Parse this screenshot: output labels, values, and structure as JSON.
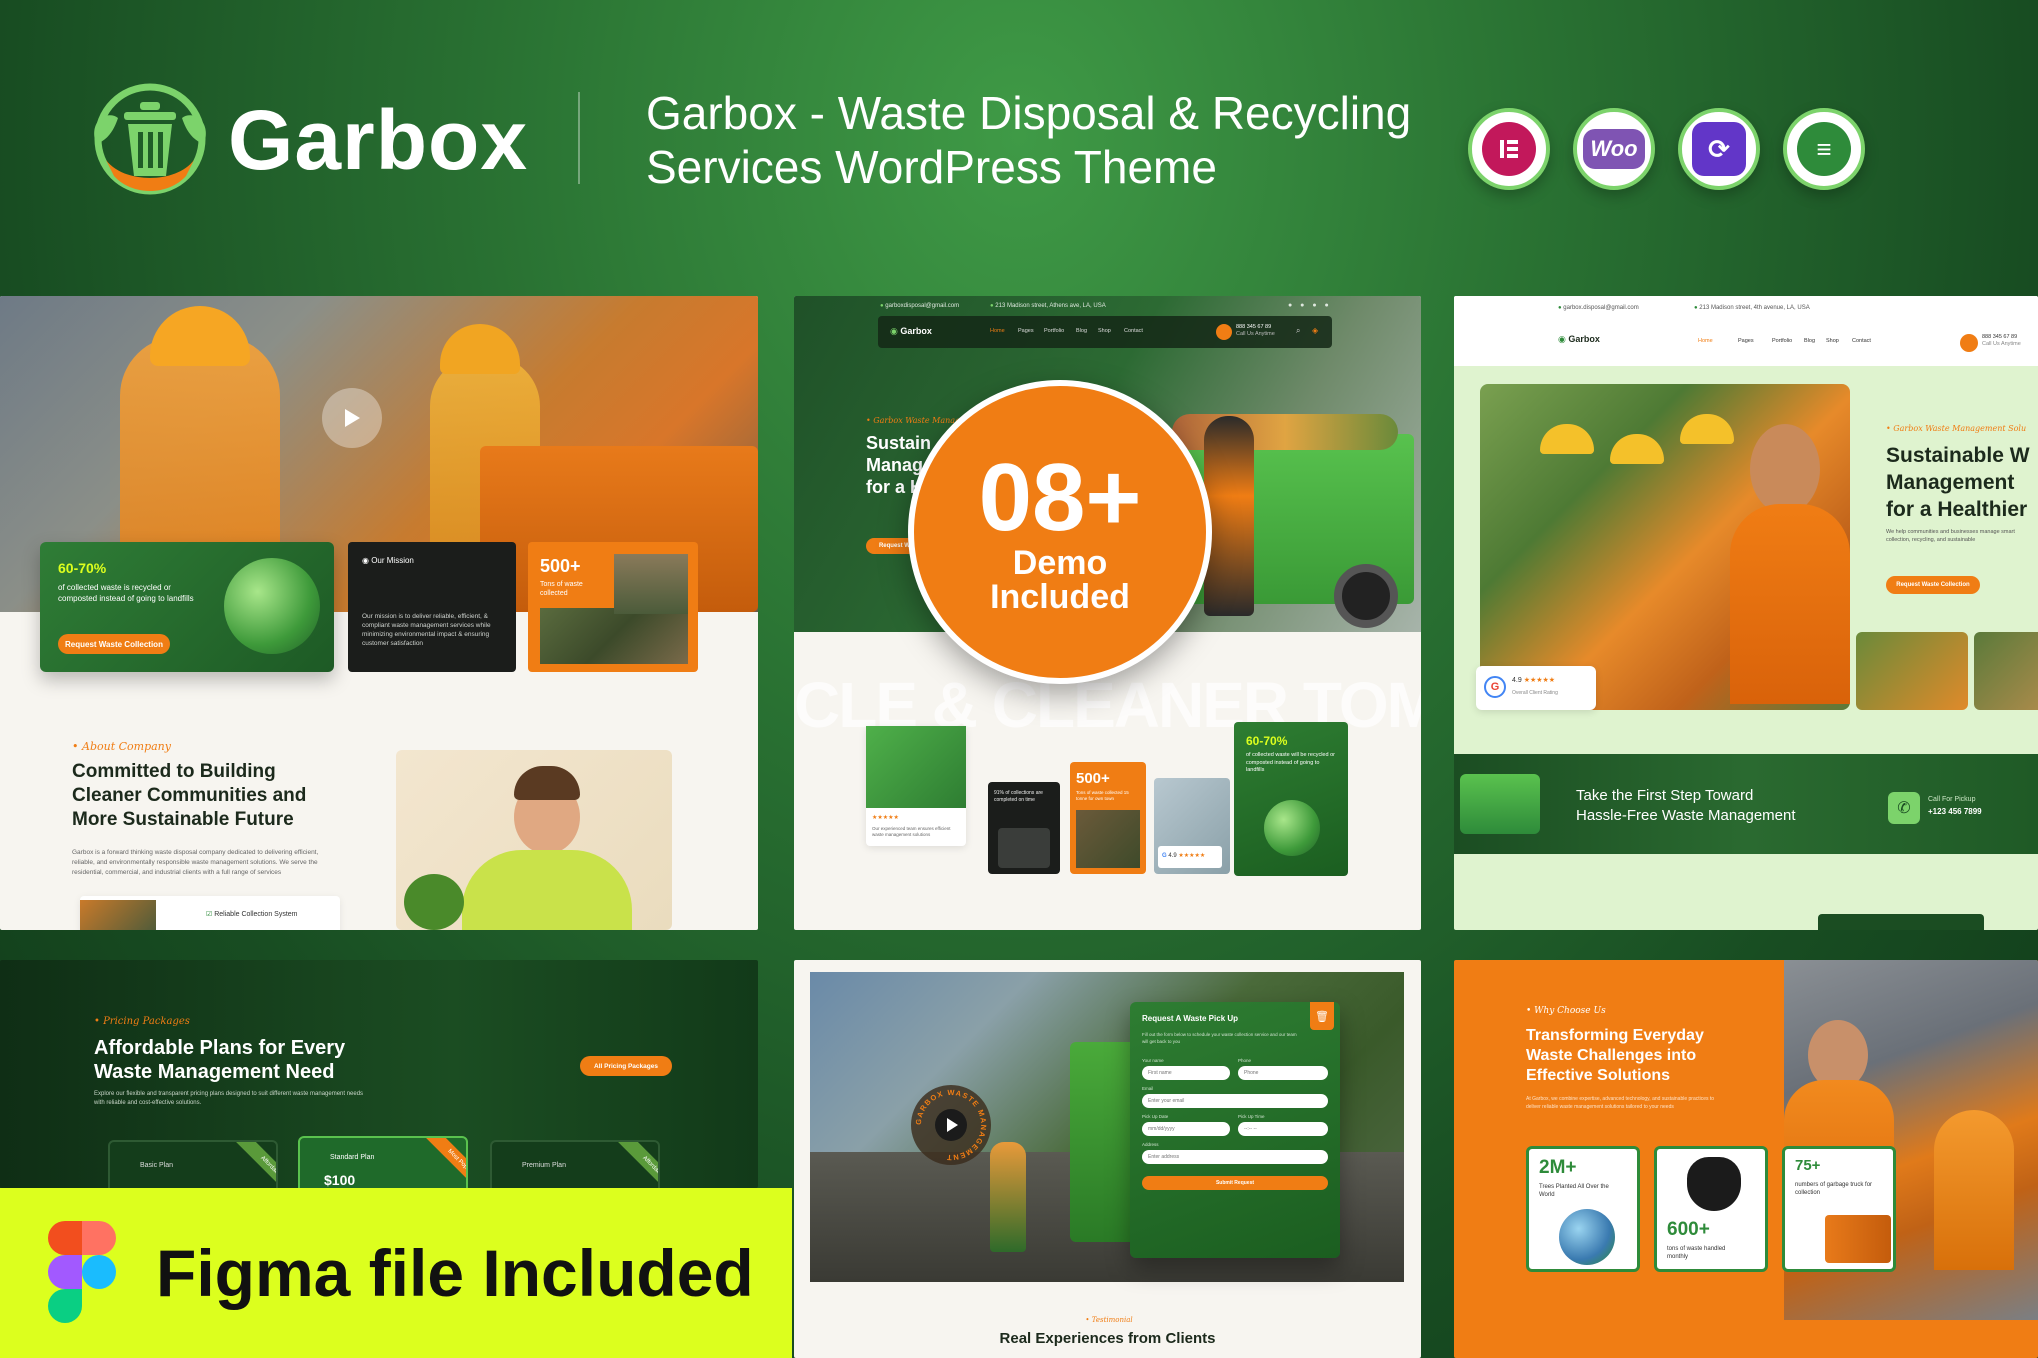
{
  "header": {
    "brand": "Garbox",
    "tagline_line1": "Garbox - Waste Disposal & Recycling",
    "tagline_line2": "Services WordPress Theme",
    "badges": [
      {
        "icon": "elementor-icon",
        "label": "E",
        "color": "#c2185b"
      },
      {
        "icon": "woocommerce-icon",
        "label": "Woo",
        "color": "#7f54b3"
      },
      {
        "icon": "update-sync-icon",
        "label": "⟳",
        "color": "#6236c8"
      },
      {
        "icon": "stack-layers-icon",
        "label": "≡",
        "color": "#2e8b3a"
      }
    ]
  },
  "colors": {
    "accent": "#f07d14",
    "brand_green": "#2a7333",
    "lime": "#dcff1e"
  },
  "demo_badge": {
    "number": "08+",
    "label_line1": "Demo",
    "label_line2": "Included"
  },
  "figma_banner": {
    "label": "Figma file Included"
  },
  "panel1": {
    "stat1_value": "60-70%",
    "stat1_text": "of collected waste is recycled or composted instead of going to landfills",
    "stat1_button": "Request Waste Collection",
    "mission_title": "Our Mission",
    "mission_text": "Our mission is to deliver reliable, efficient, & compliant waste management services while minimizing environmental impact & ensuring customer satisfaction",
    "stat2_value": "500+",
    "stat2_text": "Tons of waste collected",
    "about_eyebrow": "About Company",
    "about_h1": "Committed to Building",
    "about_h2": "Cleaner Communities and",
    "about_h3": "More Sustainable Future",
    "about_text": "Garbox is a forward thinking waste disposal company dedicated to delivering efficient, reliable, and environmentally responsible waste management solutions. We serve the residential, commercial, and industrial clients with a full range of services",
    "about_check": "Reliable Collection System"
  },
  "panel2": {
    "topbar_email": "garboxdisposal@gmail.com",
    "topbar_address": "213 Madison street, Athens ave, LA, USA",
    "nav_brand": "Garbox",
    "nav_items": [
      "Home",
      "Pages",
      "Portfolio",
      "Blog",
      "Shop",
      "Contact"
    ],
    "phone": "888 345 67 89",
    "phone_label": "Call Us Anytime",
    "hero_eyebrow": "Garbox Waste Management",
    "hero_h1": "Sustain",
    "hero_h2": "Manag",
    "hero_h3": "for a H",
    "hero_button": "Request Wa",
    "watermark": "CLE & CLEANER TOMO",
    "card_percent_text": "91% of collections are completed on time",
    "card_500": "500+",
    "card_500_text": "Tons of waste collected 15 tonne for own town",
    "card_rating": "4.9",
    "stars": "★★★★★",
    "card_team_text": "Our experienced team ensures efficient waste management solutions",
    "card_stat_value": "60-70%",
    "card_stat_text": "of collected waste will be recycled or composted instead of going to landfills"
  },
  "panel3": {
    "topbar_email": "garbox.disposal@gmail.com",
    "topbar_address": "213 Madison street, 4th avenue, LA, USA",
    "nav_brand": "Garbox",
    "nav_items": [
      "Home",
      "Pages",
      "Portfolio",
      "Blog",
      "Shop",
      "Contact"
    ],
    "phone": "888 345 67 89",
    "phone_label": "Call Us Anytime",
    "hero_eyebrow": "Garbox Waste Management Solu",
    "hero_h1": "Sustainable W",
    "hero_h2": "Management",
    "hero_h3": "for a Healthier",
    "hero_text": "We help communities and businesses manage smart collection, recycling, and sustainable",
    "hero_button": "Request Waste Collection",
    "rating_value": "4.9",
    "stars": "★★★★★",
    "rating_label": "Overall Client Rating",
    "cta_line1": "Take the First Step Toward",
    "cta_line2": "Hassle-Free Waste Management",
    "call_label": "Call For Pickup",
    "call_number": "+123 456 7899"
  },
  "panel4": {
    "eyebrow": "Pricing Packages",
    "h1": "Affordable Plans for Every",
    "h2": "Waste Management Need",
    "text": "Explore our flexible and transparent pricing plans designed to suit different waste management needs with reliable and cost-effective solutions.",
    "button": "All Pricing Packages",
    "plans": [
      {
        "name": "Basic Plan",
        "ribbon": "Affordable"
      },
      {
        "name": "Standard Plan",
        "ribbon": "Most Popular",
        "price": "$100"
      },
      {
        "name": "Premium Plan",
        "ribbon": "Affordable"
      }
    ]
  },
  "panel5": {
    "form_title": "Request A Waste Pick Up",
    "form_text": "Fill out the form below to schedule your waste collection service and our team will get back to you",
    "f_name": "Your name",
    "f_name_ph": "First name",
    "f_phone": "Phone",
    "f_phone_ph": "Phone",
    "f_email": "Email",
    "f_email_ph": "Enter your email",
    "f_date": "Pick Up Date",
    "f_date_ph": "mm/dd/yyyy",
    "f_time": "Pick Up Time",
    "f_time_ph": "--:-- --",
    "f_address": "Address",
    "f_address_ph": "Enter address",
    "f_submit": "Submit Request",
    "circle_text": "GARBOX WASTE MANAGEMENT",
    "testi_eyebrow": "Testimonial",
    "testi_title": "Real Experiences from Clients"
  },
  "panel6": {
    "eyebrow": "Why Choose Us",
    "h1": "Transforming Everyday",
    "h2": "Waste Challenges into",
    "h3": "Effective Solutions",
    "text": "At Garbox, we combine expertise, advanced technology, and sustainable practices to deliver reliable waste management solutions tailored to your needs",
    "c1_value": "2M+",
    "c1_text": "Trees Planted All Over the World",
    "c2_value": "600+",
    "c2_text": "tons of waste handled monthly",
    "c3_value": "75+",
    "c3_text": "numbers of garbage truck for collection"
  }
}
